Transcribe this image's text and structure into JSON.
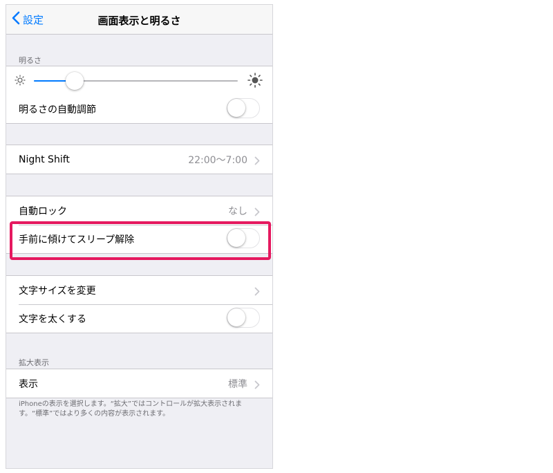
{
  "nav": {
    "back_label": "設定",
    "title": "画面表示と明るさ"
  },
  "brightness": {
    "header": "明るさ",
    "level": 0.2,
    "auto_label": "明るさの自動調節",
    "auto_on": false
  },
  "night_shift": {
    "label": "Night Shift",
    "value": "22:00〜7:00"
  },
  "lock": {
    "auto_lock_label": "自動ロック",
    "auto_lock_value": "なし",
    "raise_to_wake_label": "手前に傾けてスリープ解除",
    "raise_to_wake_on": false
  },
  "text": {
    "text_size_label": "文字サイズを変更",
    "bold_text_label": "文字を太くする",
    "bold_on": false
  },
  "zoom": {
    "header": "拡大表示",
    "view_label": "表示",
    "view_value": "標準",
    "note": "iPhoneの表示を選択します。“拡大”ではコントロールが拡大表示されます。“標準”ではより多くの内容が表示されます。"
  },
  "colors": {
    "accent": "#007aff",
    "highlight": "#e5195f",
    "background": "#efeff4"
  },
  "icons": [
    "chevron-left-icon",
    "sun-small-icon",
    "sun-large-icon",
    "chevron-right-icon"
  ]
}
